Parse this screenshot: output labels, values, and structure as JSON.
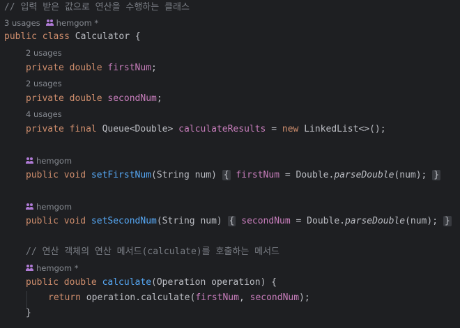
{
  "editor": {
    "comment_top": "// 입력 받은 값으로 연산을 수행하는 클래스",
    "class_meta": {
      "usages": "3 usages",
      "author": "hemgom *"
    },
    "class_decl": {
      "kw": "public class",
      "name": "Calculator",
      "brace": "{"
    },
    "fields": [
      {
        "usages": "2 usages",
        "mods": "private double",
        "name": "firstNum",
        "end": ";"
      },
      {
        "usages": "2 usages",
        "mods": "private double",
        "name": "secondNum",
        "end": ";"
      },
      {
        "usages": "4 usages",
        "mods": "private final",
        "type": "Queue<Double>",
        "name": "calculateResults",
        "eq": " = ",
        "kw_new": "new",
        "rest": "LinkedList<>();"
      }
    ],
    "setters": [
      {
        "author": "hemgom",
        "mods": "public void",
        "name": "setFirstNum",
        "params": "(String num)",
        "open": "{",
        "field": "firstNum",
        "assign": " = Double.",
        "call": "parseDouble",
        "args": "(num);",
        "close": "}"
      },
      {
        "author": "hemgom",
        "mods": "public void",
        "name": "setSecondNum",
        "params": "(String num)",
        "open": "{",
        "field": "secondNum",
        "assign": " = Double.",
        "call": "parseDouble",
        "args": "(num);",
        "close": "}"
      }
    ],
    "comment_mid": "// 연산 객체의 연산 메서드(calculate)를 호출하는 메서드",
    "calc_meta": {
      "author": "hemgom *"
    },
    "calc_decl": {
      "mods": "public double",
      "name": "calculate",
      "params": "(Operation operation) {"
    },
    "calc_body": {
      "kw": "return",
      "call": " operation.calculate(",
      "arg1": "firstNum",
      "comma": ", ",
      "arg2": "secondNum",
      "end": ");"
    },
    "calc_close": "}"
  }
}
